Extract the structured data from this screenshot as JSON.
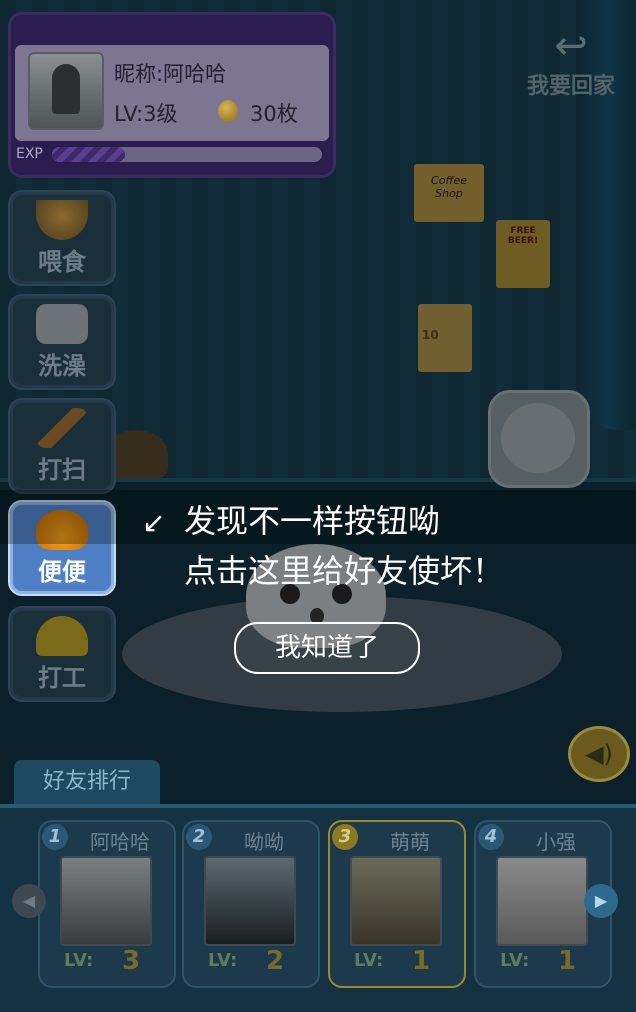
{
  "profile": {
    "nickname": "昵称:阿哈哈",
    "level": "LV:3级",
    "coins": "30枚",
    "exp_label": "EXP",
    "exp_progress": 0.27
  },
  "back_button": {
    "label": "我要回家",
    "icon": "return-arrow-icon"
  },
  "actions": [
    {
      "label": "喂食",
      "icon": "bowl-icon"
    },
    {
      "label": "洗澡",
      "icon": "soap-icon"
    },
    {
      "label": "打扫",
      "icon": "broom-icon"
    },
    {
      "label": "便便",
      "icon": "poop-icon"
    },
    {
      "label": "打工",
      "icon": "hardhat-icon"
    }
  ],
  "tip": {
    "line1": "发现不一样按钮呦",
    "line2": "点击这里给好友使坏！",
    "confirm": "我知道了"
  },
  "wall_decor": {
    "coffee_sign": "Coffee Shop",
    "beer_sign": "FREE BEER!",
    "icecream_sign": "10"
  },
  "friends": {
    "tab_label": "好友排行",
    "lv_label": "LV:",
    "items": [
      {
        "rank": "1",
        "name": "阿哈哈",
        "level": "3"
      },
      {
        "rank": "2",
        "name": "呦呦",
        "level": "2"
      },
      {
        "rank": "3",
        "name": "萌萌",
        "level": "1"
      },
      {
        "rank": "4",
        "name": "小强",
        "level": "1"
      }
    ]
  },
  "colors": {
    "highlight": "#4f7fc4",
    "profile_bg": "#2b1d4e",
    "room_wall": "#173f50"
  }
}
